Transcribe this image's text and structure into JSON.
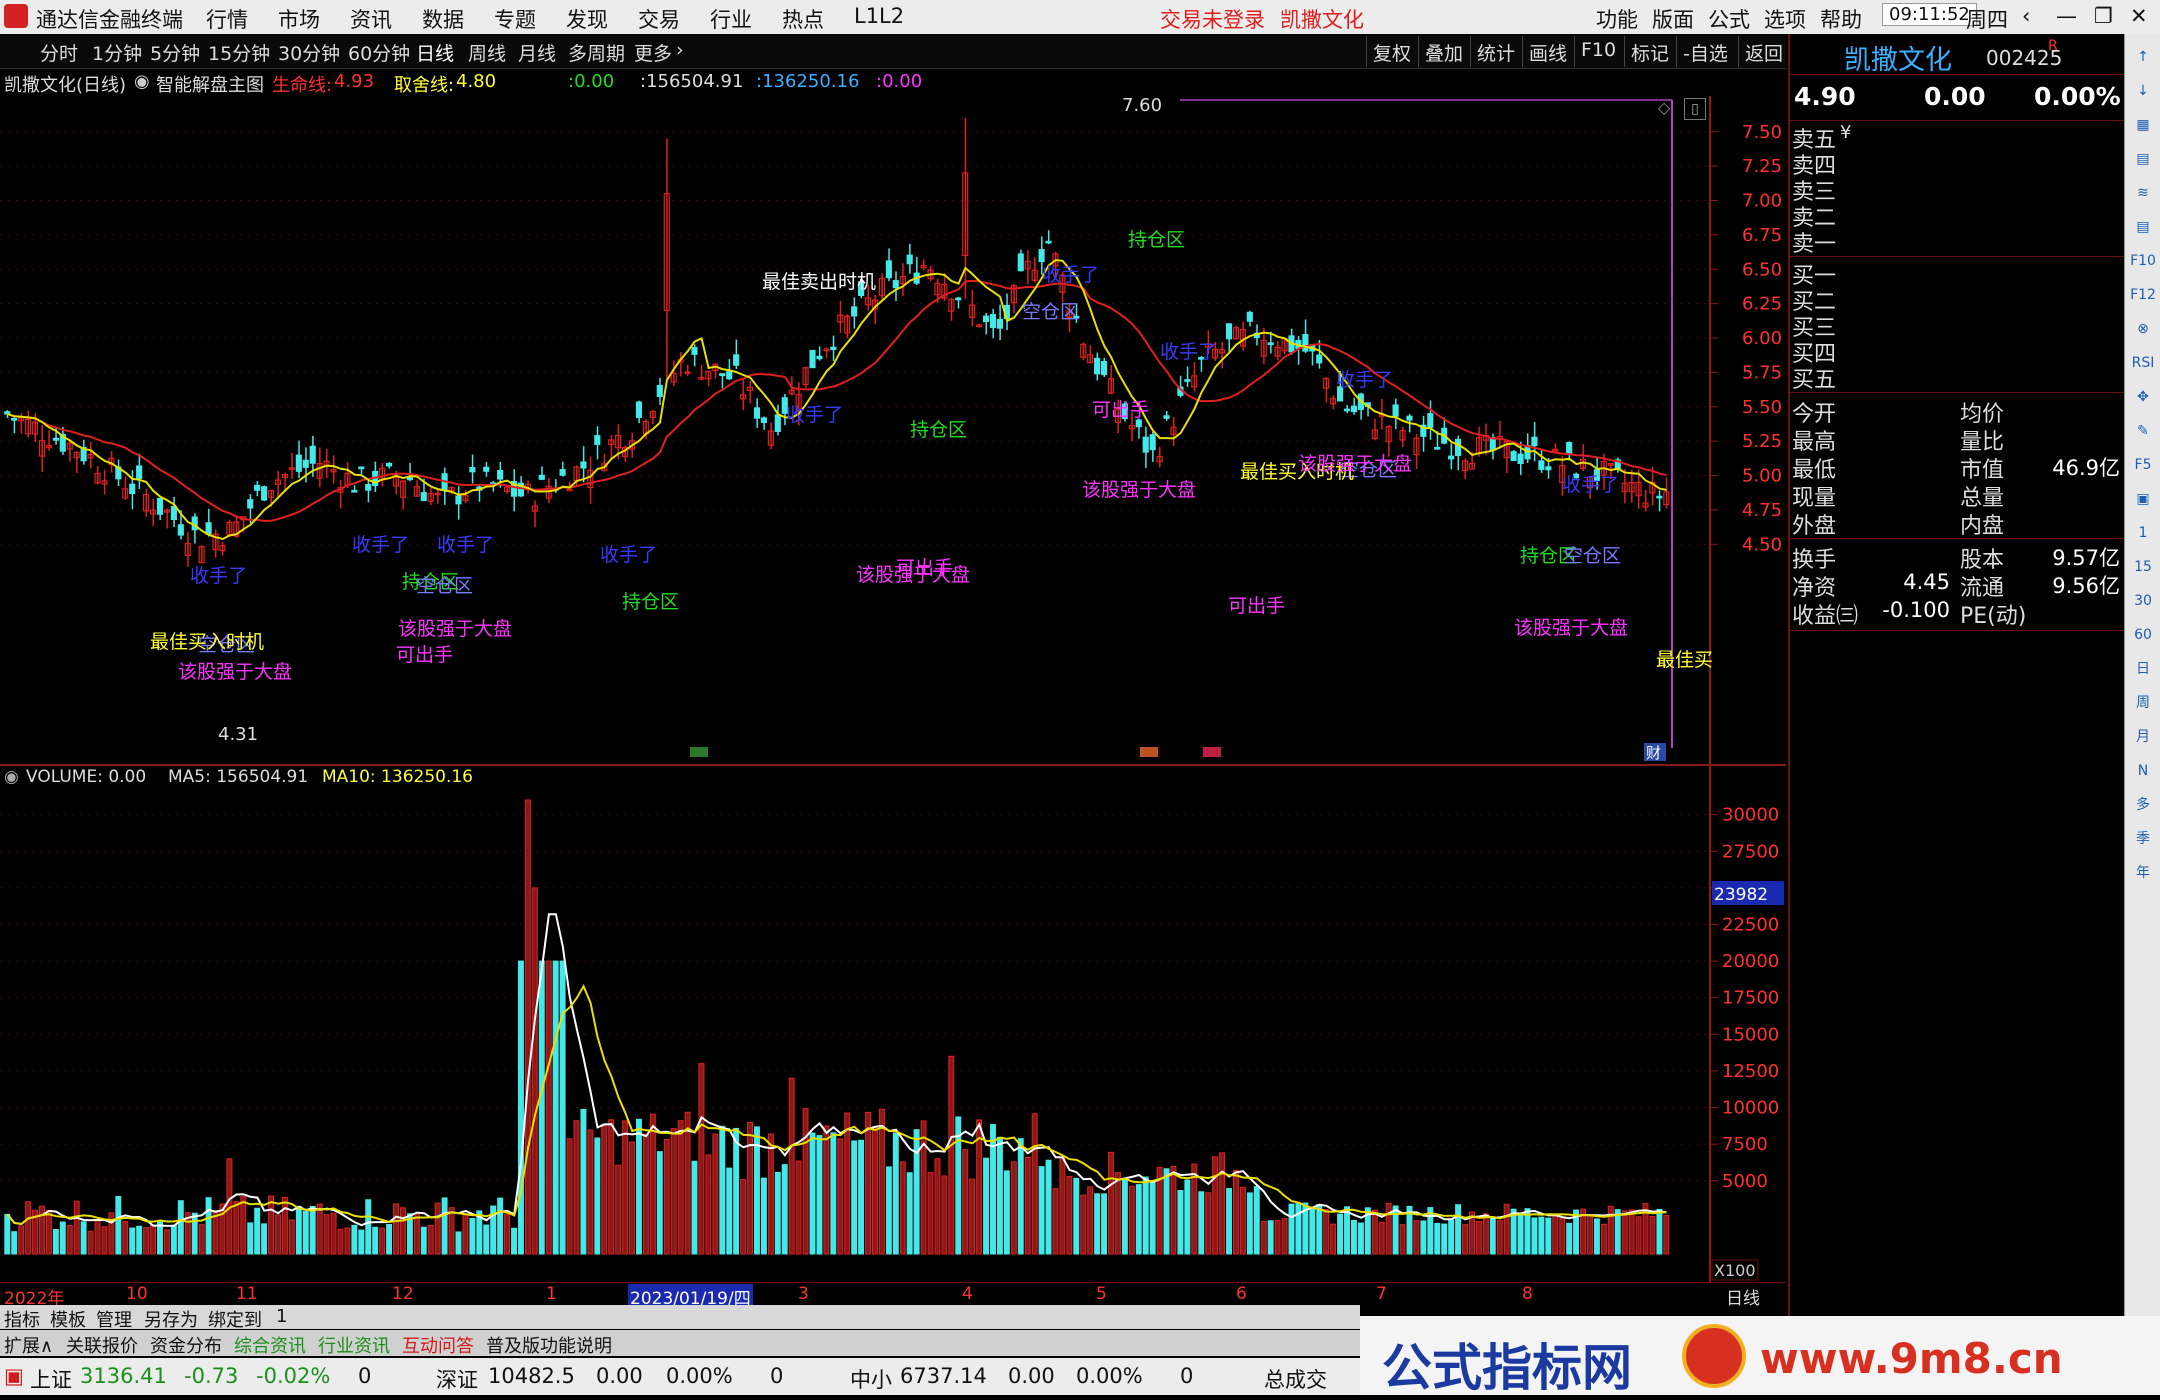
{
  "titlebar": {
    "app_title": "通达信金融终端",
    "menus": [
      "行情",
      "市场",
      "资讯",
      "数据",
      "专题",
      "发现",
      "交易",
      "行业",
      "热点",
      "L1L2"
    ],
    "login_status": "交易未登录",
    "stock_name": "凯撒文化",
    "right_menus": [
      "功能",
      "版面",
      "公式",
      "选项",
      "帮助"
    ],
    "clock": "09:11:52",
    "weekday": "周四"
  },
  "toolbar": {
    "periods": [
      "分时",
      "1分钟",
      "5分钟",
      "15分钟",
      "30分钟",
      "60分钟",
      "日线",
      "周线",
      "月线",
      "多周期",
      "更多"
    ],
    "active_period": "日线",
    "actions": [
      "复权",
      "叠加",
      "统计",
      "画线",
      "F10",
      "标记",
      "-自选",
      "返回"
    ]
  },
  "infoline": {
    "stock": "凯撒文化(日线)",
    "indicator": "智能解盘主图",
    "life_line_label": "生命线:",
    "life_line_value": "4.93",
    "decide_line_label": "取舍线:",
    "decide_line_value": "4.80",
    "v1": ":0.00",
    "v2": ":156504.91",
    "v3": ":136250.16",
    "v4": ":0.00"
  },
  "main_axis": {
    "ticks": [
      "7.50",
      "7.25",
      "7.00",
      "6.75",
      "6.50",
      "6.25",
      "6.00",
      "5.75",
      "5.50",
      "5.25",
      "5.00",
      "4.75",
      "4.50"
    ],
    "high_mark": "7.60",
    "low_mark": "4.31"
  },
  "signals": [
    {
      "t": "收手了",
      "c": "#3a3aff",
      "pos": "a"
    },
    {
      "t": "收手了",
      "c": "#3a3aff",
      "pos": "b"
    },
    {
      "t": "收手了",
      "c": "#3a3aff",
      "pos": "c"
    },
    {
      "t": "收手了",
      "c": "#3a3aff",
      "pos": "d"
    },
    {
      "t": "收手了",
      "c": "#3a3aff",
      "pos": "e"
    },
    {
      "t": "收手了",
      "c": "#3a3aff",
      "pos": "f"
    },
    {
      "t": "收手了",
      "c": "#3a3aff",
      "pos": "g"
    },
    {
      "t": "收手了",
      "c": "#3a3aff",
      "pos": "h"
    },
    {
      "t": "收手了",
      "c": "#3a3aff",
      "pos": "i"
    },
    {
      "t": "持仓区",
      "c": "#22dd22",
      "pos": "j"
    },
    {
      "t": "持仓区",
      "c": "#22dd22",
      "pos": "k"
    },
    {
      "t": "持仓区",
      "c": "#22dd22",
      "pos": "l"
    },
    {
      "t": "持仓区",
      "c": "#22dd22",
      "pos": "m"
    },
    {
      "t": "持仓区",
      "c": "#22dd22",
      "pos": "n"
    },
    {
      "t": "空仓区",
      "c": "#7a7aff",
      "pos": "o"
    },
    {
      "t": "空仓区",
      "c": "#7a7aff",
      "pos": "p"
    },
    {
      "t": "空仓区",
      "c": "#7a7aff",
      "pos": "q"
    },
    {
      "t": "空仓区",
      "c": "#7a7aff",
      "pos": "r"
    },
    {
      "t": "空仓区",
      "c": "#7a7aff",
      "pos": "s"
    },
    {
      "t": "最佳卖出时机",
      "c": "#ffffff",
      "pos": "t"
    },
    {
      "t": "最佳买入时机",
      "c": "#ffff33",
      "pos": "u"
    },
    {
      "t": "最佳买入时机",
      "c": "#ffff33",
      "pos": "v"
    },
    {
      "t": "最佳买",
      "c": "#ffff33",
      "pos": "w"
    },
    {
      "t": "该股强于大盘",
      "c": "#ff33ff",
      "pos": "x"
    },
    {
      "t": "该股强于大盘",
      "c": "#ff33ff",
      "pos": "y"
    },
    {
      "t": "该股强于大盘",
      "c": "#ff33ff",
      "pos": "z"
    },
    {
      "t": "该股强于大盘",
      "c": "#ff33ff",
      "pos": "aa"
    },
    {
      "t": "该股强于大盘",
      "c": "#ff33ff",
      "pos": "ab"
    },
    {
      "t": "该股强于大盘",
      "c": "#ff33ff",
      "pos": "ac"
    },
    {
      "t": "可出手",
      "c": "#ff33ff",
      "pos": "ad"
    },
    {
      "t": "可出手",
      "c": "#ff33ff",
      "pos": "ae"
    },
    {
      "t": "可出手",
      "c": "#ff33ff",
      "pos": "af"
    },
    {
      "t": "可出手",
      "c": "#ff33ff",
      "pos": "ag"
    }
  ],
  "event_tags": [
    "财"
  ],
  "volume": {
    "label": "VOLUME: 0.00",
    "ma5": "MA5: 156504.91",
    "ma10": "MA10: 136250.16",
    "ticks": [
      "30000",
      "27500",
      "25000",
      "22500",
      "20000",
      "17500",
      "15000",
      "12500",
      "10000",
      "7500",
      "5000"
    ],
    "current_box": "23982",
    "unit": "X100"
  },
  "dates": {
    "labels": [
      "2022年",
      "10",
      "11",
      "12",
      "1",
      "2023/01/19/四",
      "3",
      "4",
      "5",
      "6",
      "7",
      "8"
    ],
    "period": "日线"
  },
  "quote": {
    "name": "凯撒文化",
    "code": "002425",
    "mark": "R",
    "price": "4.90",
    "change": "0.00",
    "pct": "0.00%",
    "sells": [
      "卖五",
      "卖四",
      "卖三",
      "卖二",
      "卖一"
    ],
    "sell5_suffix": "¥",
    "buys": [
      "买一",
      "买二",
      "买三",
      "买四",
      "买五"
    ],
    "stats_left": [
      "今开",
      "最高",
      "最低",
      "现量",
      "外盘"
    ],
    "stats_right": [
      "均价",
      "量比",
      "市值",
      "总量",
      "内盘"
    ],
    "market_cap": "46.9亿",
    "row2_left": [
      "换手",
      "净资",
      "收益㈢"
    ],
    "row2_left_vals": [
      "",
      "4.45",
      "-0.100"
    ],
    "row2_right": [
      "股本",
      "流通",
      "PE(动)"
    ],
    "row2_right_vals": [
      "9.57亿",
      "9.56亿",
      ""
    ]
  },
  "iconcol": [
    "↑",
    "↓",
    "▦",
    "▤",
    "≋",
    "▤",
    "F10",
    "F12",
    "⊗",
    "RSI",
    "✥",
    "✎",
    "F5",
    "▣",
    "1",
    "15",
    "30",
    "60",
    "日",
    "周",
    "月",
    "N",
    "多",
    "季",
    "年"
  ],
  "bottom": {
    "tabs1": [
      "指标",
      "模板",
      "管理",
      "另存为",
      "绑定到",
      "1"
    ],
    "tabs2": [
      "扩展∧",
      "关联报价",
      "资金分布",
      "综合资讯",
      "行业资讯",
      "互动问答",
      "普及版功能说明"
    ],
    "tabs2_colors": [
      "#111",
      "#111",
      "#111",
      "#1a8f1a",
      "#1a8f1a",
      "#d01a1a",
      "#111"
    ],
    "index1_name": "上证",
    "index1_val": "3136.41",
    "index1_chg": "-0.73",
    "index1_pct": "-0.02%",
    "index1_vol": "0",
    "index2_name": "深证",
    "index2_val": "10482.5",
    "index2_chg": "0.00",
    "index2_pct": "0.00%",
    "index2_vol": "0",
    "index3_name": "中小",
    "index3_val": "6737.14",
    "index3_chg": "0.00",
    "index3_pct": "0.00%",
    "index3_vol": "0",
    "deal_label": "总成交"
  },
  "watermark": {
    "text": "公式指标网",
    "url": "www.9m8.cn"
  }
}
